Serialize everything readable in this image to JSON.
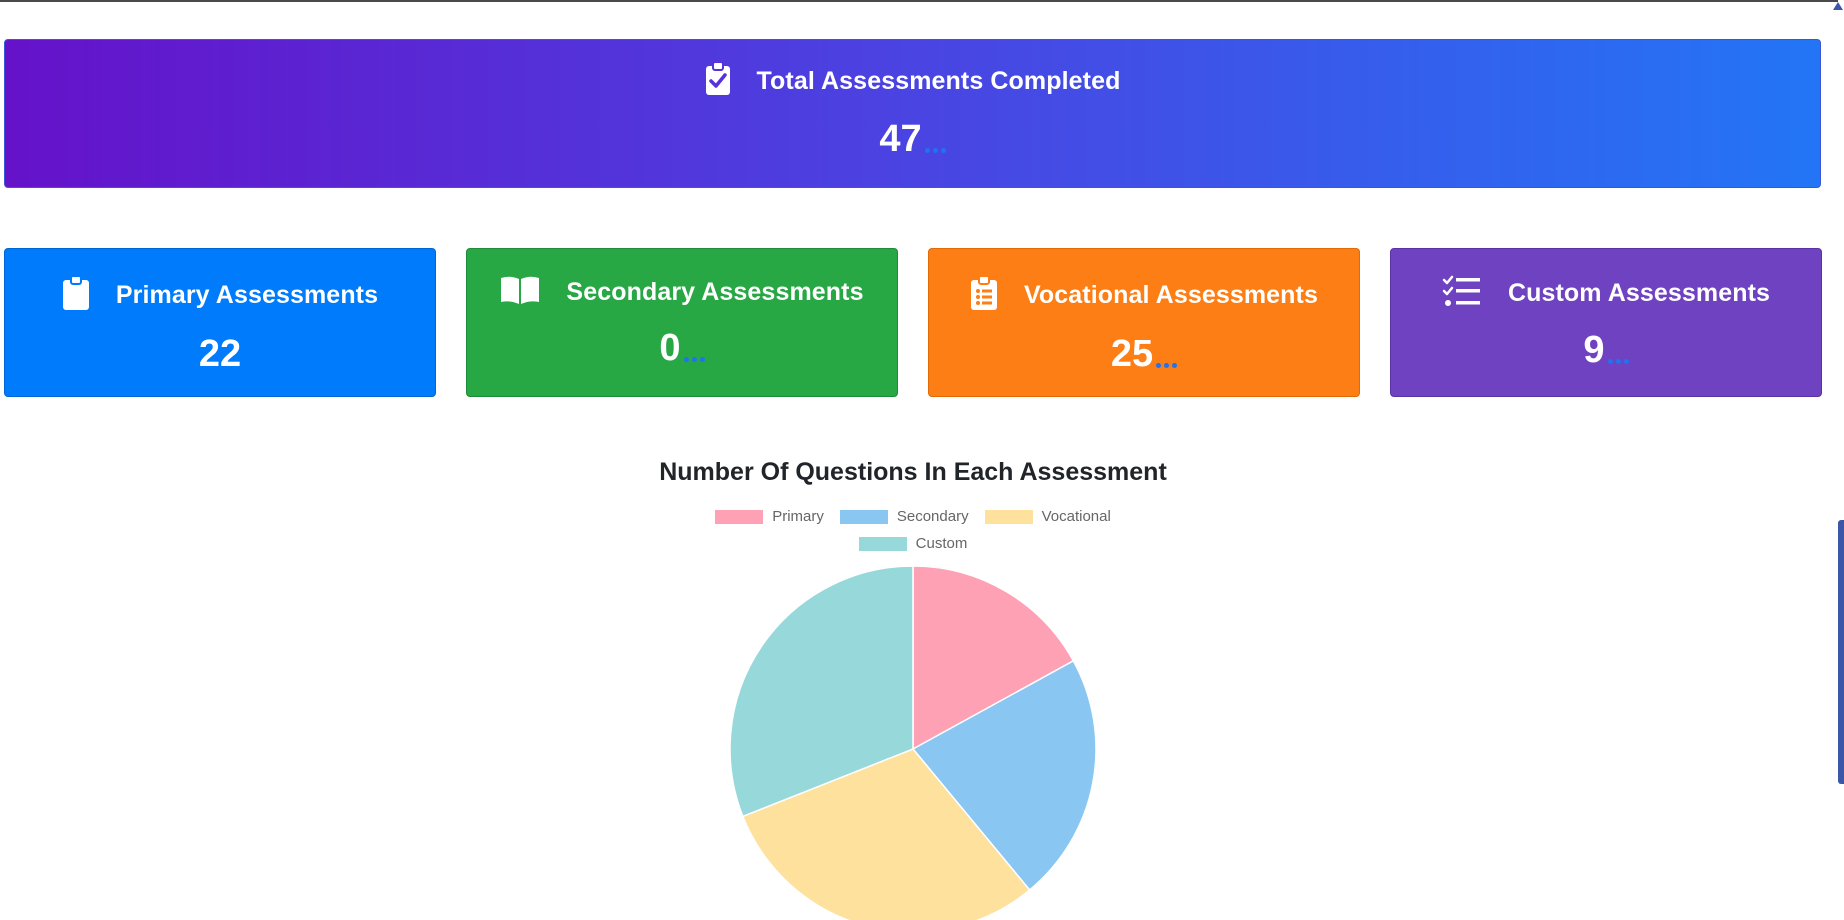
{
  "total": {
    "title": "Total Assessments Completed",
    "value": "47",
    "icon": "clipboard-check-icon"
  },
  "cards": [
    {
      "key": "primary",
      "title": "Primary Assessments",
      "value": "22",
      "icon": "clipboard-icon",
      "color": "#007bfc"
    },
    {
      "key": "secondary",
      "title": "Secondary Assessments",
      "value": "0",
      "icon": "open-book-icon",
      "color": "#28a745"
    },
    {
      "key": "vocational",
      "title": "Vocational Assessments",
      "value": "25",
      "icon": "clipboard-list-icon",
      "color": "#fd7e14"
    },
    {
      "key": "custom",
      "title": "Custom Assessments",
      "value": "9",
      "icon": "checklist-icon",
      "color": "#6f42c1"
    }
  ],
  "chart_data": {
    "type": "pie",
    "title": "Number Of Questions In Each Assessment",
    "legend_position": "top",
    "categories": [
      "Primary",
      "Secondary",
      "Vocational",
      "Custom"
    ],
    "values": [
      17,
      22,
      30,
      31
    ],
    "colors": [
      "#ffa1b4",
      "#89c6f2",
      "#fde19c",
      "#97d9db"
    ]
  }
}
